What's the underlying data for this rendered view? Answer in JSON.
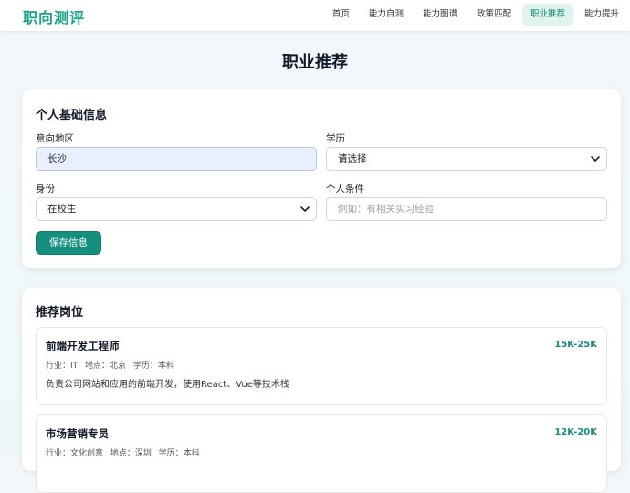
{
  "app": {
    "logo": "职向测评",
    "brand_color": "#19a68a",
    "accent_color": "#16907e"
  },
  "nav": {
    "items": [
      {
        "label": "首页",
        "active": false
      },
      {
        "label": "能力自测",
        "active": false
      },
      {
        "label": "能力图谱",
        "active": false
      },
      {
        "label": "政策匹配",
        "active": false
      },
      {
        "label": "职业推荐",
        "active": true
      },
      {
        "label": "能力提升",
        "active": false
      }
    ]
  },
  "page": {
    "title": "职业推荐"
  },
  "info_form": {
    "title": "个人基础信息",
    "region": {
      "label": "意向地区",
      "value": "长沙"
    },
    "education": {
      "label": "学历",
      "value": "请选择"
    },
    "identity": {
      "label": "身份",
      "value": "在校生"
    },
    "conditions": {
      "label": "个人条件",
      "placeholder": "例如：有相关实习经验"
    },
    "save_label": "保存信息"
  },
  "recommendations": {
    "title": "推荐岗位",
    "jobs": [
      {
        "title": "前端开发工程师",
        "salary": "15K-25K",
        "industry": "行业：IT",
        "location": "地点：北京",
        "education": "学历：本科",
        "description": "负责公司网站和应用的前端开发，使用React、Vue等技术栈"
      },
      {
        "title": "市场营销专员",
        "salary": "12K-20K",
        "industry": "行业：文化创意",
        "location": "地点：深圳",
        "education": "学历：本科",
        "description": ""
      }
    ]
  }
}
